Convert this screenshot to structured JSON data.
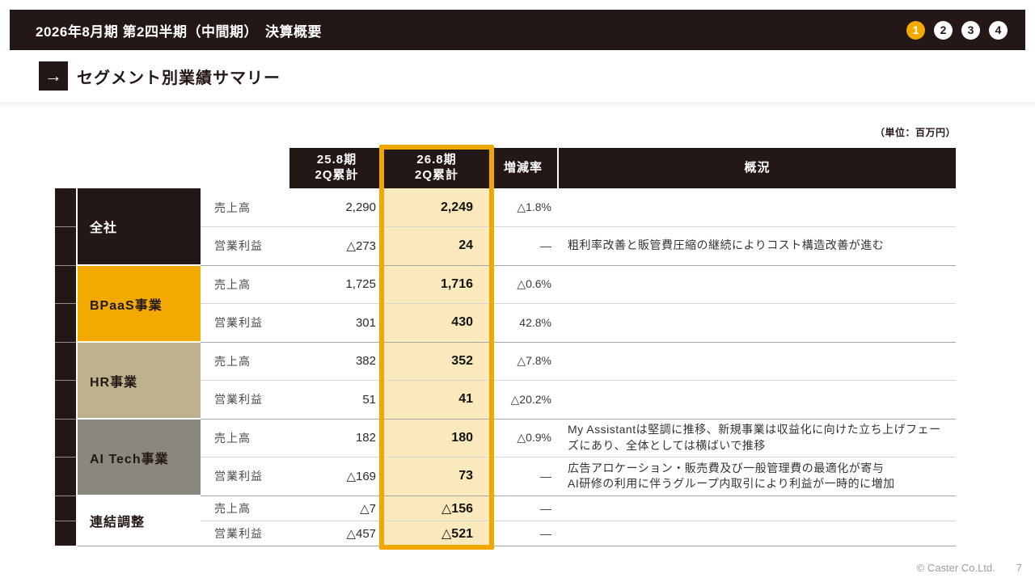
{
  "slide": {
    "top_bar": {
      "title": "2026年8月期 第2四半期（中間期）　決算概要"
    },
    "pager": {
      "items": [
        {
          "label": "1",
          "active": true,
          "bg": "#F2A900",
          "fg": "#ffffff"
        },
        {
          "label": "2",
          "active": false,
          "bg": "#ffffff",
          "fg": "#231815"
        },
        {
          "label": "3",
          "active": false,
          "bg": "#ffffff",
          "fg": "#231815"
        },
        {
          "label": "4",
          "active": false,
          "bg": "#ffffff",
          "fg": "#231815"
        }
      ]
    },
    "section": {
      "arrow_icon": "→",
      "title": "セグメント別業績サマリー"
    },
    "unit_note": "（単位：百万円）",
    "table": {
      "headers": {
        "prev": "25.8期\n2Q累計",
        "curr": "26.8期\n2Q累計",
        "rate": "増減率",
        "overview": "概況"
      },
      "segments": [
        {
          "name": "全社",
          "bg": "#231815",
          "fg": "#ffffff",
          "rows": [
            {
              "metric": "売上高",
              "prev": "2,290",
              "curr": "2,249",
              "rate": "△1.8%",
              "overview": ""
            },
            {
              "metric": "営業利益",
              "prev": "△273",
              "curr": "24",
              "rate": "—",
              "overview": "粗利率改善と販管費圧縮の継続によりコスト構造改善が進む"
            }
          ]
        },
        {
          "name": "BPaaS事業",
          "bg": "#F2A900",
          "fg": "#231815",
          "rows": [
            {
              "metric": "売上高",
              "prev": "1,725",
              "curr": "1,716",
              "rate": "△0.6%",
              "overview": ""
            },
            {
              "metric": "営業利益",
              "prev": "301",
              "curr": "430",
              "rate": "42.8%",
              "overview": ""
            }
          ]
        },
        {
          "name": "HR事業",
          "bg": "#BEB28E",
          "fg": "#231815",
          "rows": [
            {
              "metric": "売上高",
              "prev": "382",
              "curr": "352",
              "rate": "△7.8%",
              "overview": ""
            },
            {
              "metric": "営業利益",
              "prev": "51",
              "curr": "41",
              "rate": "△20.2%",
              "overview": ""
            }
          ]
        },
        {
          "name": "AI Tech事業",
          "bg": "#8A8781",
          "fg": "#231815",
          "rows": [
            {
              "metric": "売上高",
              "prev": "182",
              "curr": "180",
              "rate": "△0.9%",
              "overview": "My Assistantは堅調に推移、新規事業は収益化に向けた立ち上げフェーズにあり、全体としては横ばいで推移"
            },
            {
              "metric": "営業利益",
              "prev": "△169",
              "curr": "73",
              "rate": "—",
              "overview": "広告アロケーション・販売費及び一般管理費の最適化が寄与\nAI研修の利用に伴うグループ内取引により利益が一時的に増加"
            }
          ]
        },
        {
          "name": "連結調整",
          "bg": "#ffffff",
          "fg": "#231815",
          "rows": [
            {
              "metric": "売上高",
              "prev": "△7",
              "curr": "△156",
              "rate": "—",
              "overview": ""
            },
            {
              "metric": "営業利益",
              "prev": "△457",
              "curr": "△521",
              "rate": "—",
              "overview": ""
            }
          ]
        }
      ]
    },
    "footer": {
      "copyright": "© Caster Co.Ltd.",
      "page_number": "7"
    },
    "colors": {
      "dark": "#231815",
      "accent_orange": "#F2A900",
      "frame_orange": "#F0A800",
      "highlight_cream": "#FAE9BC",
      "hr_tan": "#BEB28E",
      "ai_gray": "#8A8781"
    }
  }
}
